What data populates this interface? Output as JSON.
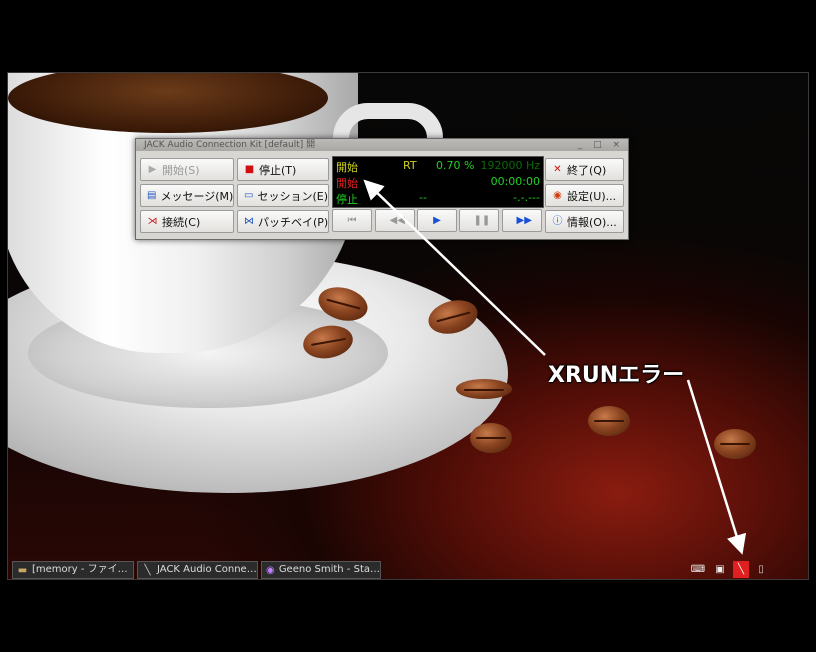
{
  "window": {
    "title": "JACK Audio Connection Kit [default] 開",
    "controls": "_ □ ×"
  },
  "buttons": {
    "start": "開始(S)",
    "stop": "停止(T)",
    "messages": "メッセージ(M)",
    "session": "セッション(E)",
    "connect": "接続(C)",
    "patchbay": "パッチベイ(P)",
    "quit": "終了(Q)",
    "setup": "設定(U)...",
    "about": "情報(O)..."
  },
  "display": {
    "state_started": "開始",
    "state_red": "開始",
    "state_stopped": "停止",
    "rt_label": "RT",
    "dsp_load": "0.70 %",
    "sample_rate": "192000 Hz",
    "time": "00:00:00",
    "transport_bpm": "--",
    "transport_time": "-.-.---"
  },
  "annotation": {
    "text": "XRUNエラー"
  },
  "taskbar": {
    "tasks": [
      {
        "label": "[memory - ファイ…",
        "icon": "folder-icon"
      },
      {
        "label": "JACK Audio Conne…",
        "icon": "jack-icon"
      },
      {
        "label": "Geeno Smith - Sta…",
        "icon": "media-player-icon"
      }
    ]
  },
  "colors": {
    "display_green": "#20d020",
    "display_yellow": "#d0d020",
    "display_red": "#e02020",
    "accent_blue": "#1a4fd8",
    "tray_alert": "#e02020"
  }
}
